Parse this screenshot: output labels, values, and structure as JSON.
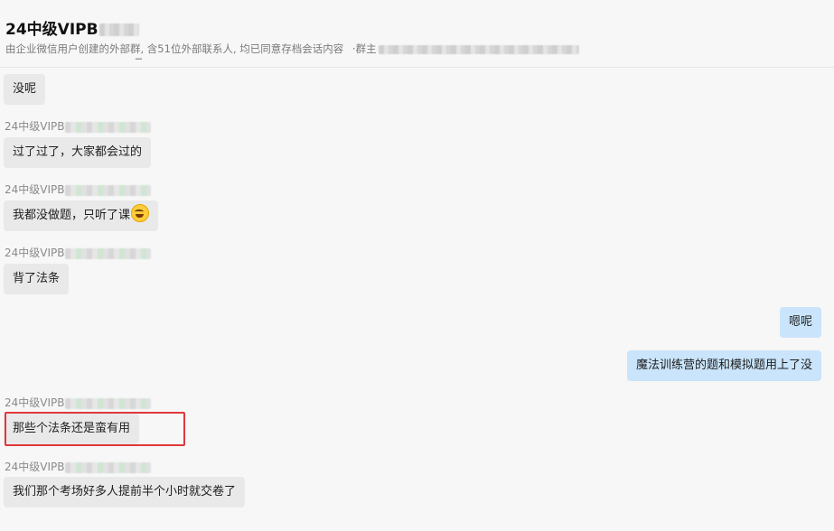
{
  "header": {
    "title": "24中级VIPB",
    "subtitle": "由企业微信用户创建的外部群, 含51位外部联系人, 均已同意存档会话内容",
    "owner_label": "·群主"
  },
  "messages": [
    {
      "side": "left",
      "sender": "",
      "text": "没呢"
    },
    {
      "side": "left",
      "sender": "24中级VIPB",
      "text": "过了过了，大家都会过的"
    },
    {
      "side": "left",
      "sender": "24中级VIPB",
      "text": "我都没做题，只听了课",
      "emoji": "grinning-sweat-emoji"
    },
    {
      "side": "left",
      "sender": "24中级VIPB",
      "text": "背了法条"
    },
    {
      "side": "right",
      "sender": "",
      "text": "嗯呢"
    },
    {
      "side": "right",
      "sender": "",
      "text": "魔法训练营的题和模拟题用上了没"
    },
    {
      "side": "left",
      "sender": "24中级VIPB",
      "text": "那些个法条还是蛮有用",
      "highlighted": true
    },
    {
      "side": "left",
      "sender": "24中级VIPB",
      "text": "我们那个考场好多人提前半个小时就交卷了"
    }
  ],
  "colors": {
    "background": "#f7f7f7",
    "bubble_other": "#e9e9e9",
    "bubble_mine": "#c9e4fb",
    "highlight": "#e0383b"
  }
}
